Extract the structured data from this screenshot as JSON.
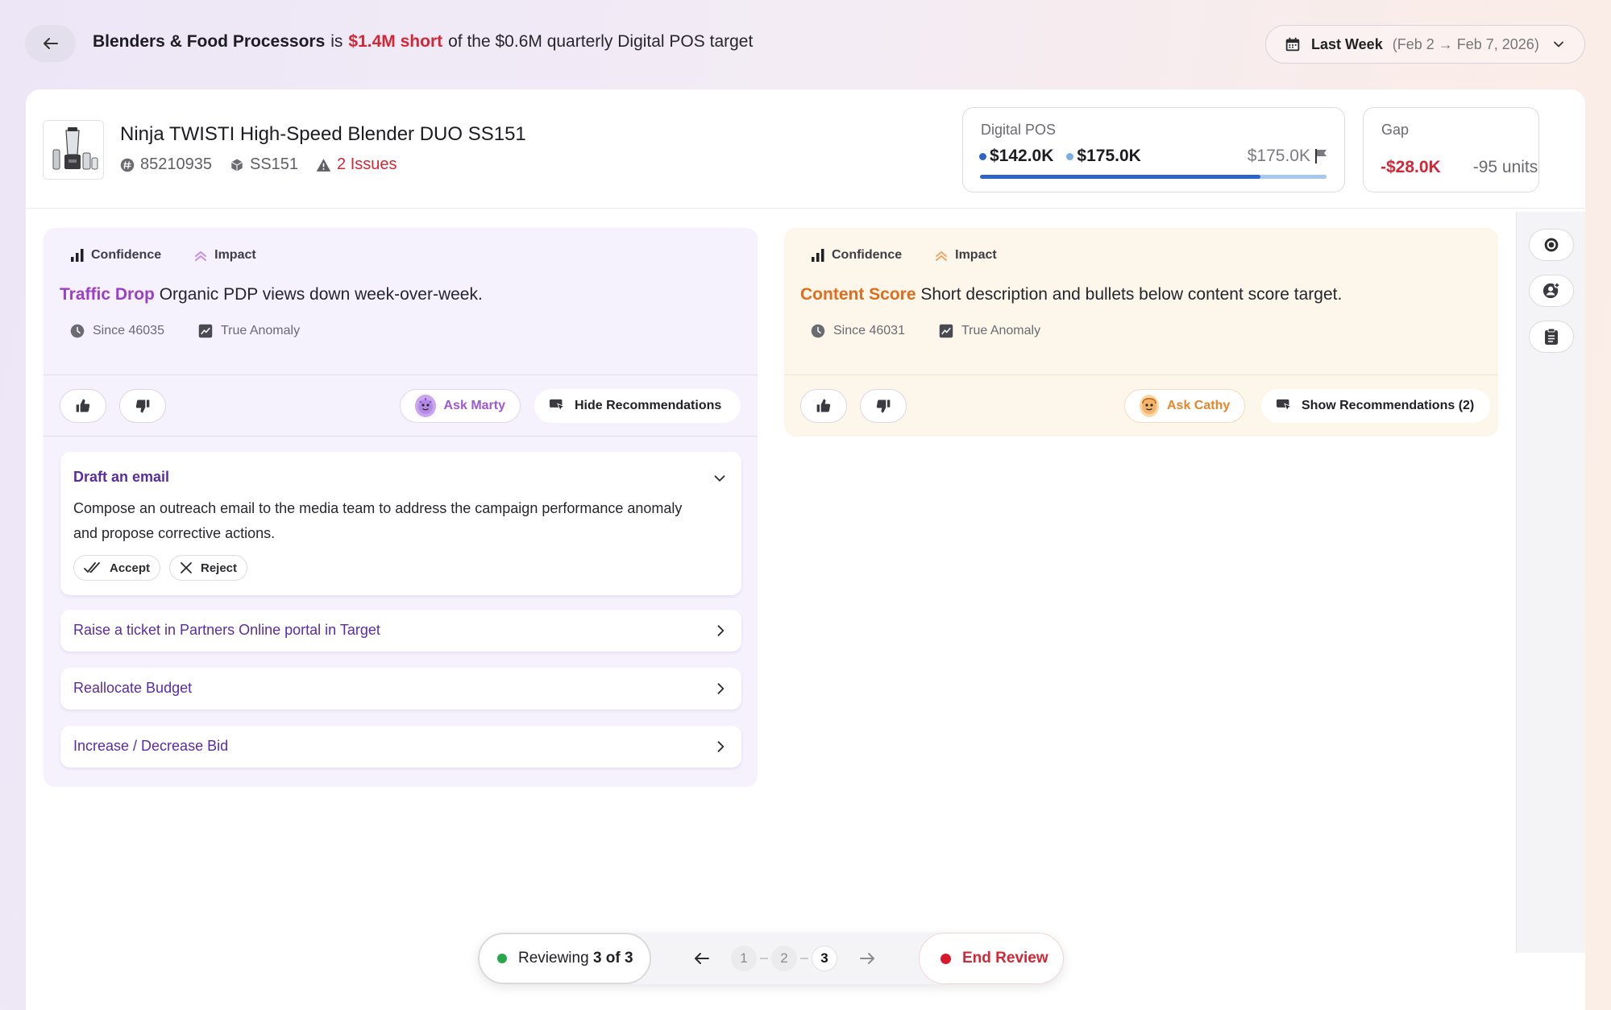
{
  "header": {
    "category": "Blenders & Food Processors",
    "verb": "is",
    "shortfall": "$1.4M short",
    "target_text": "of the $0.6M quarterly Digital POS target"
  },
  "date_filter": {
    "label": "Last Week",
    "range": "(Feb 2 → Feb 7, 2026)"
  },
  "product": {
    "title": "Ninja TWISTI High-Speed Blender DUO SS151",
    "item_id": "85210935",
    "model": "SS151",
    "issues": "2 Issues"
  },
  "kpi_pos": {
    "title": "Digital POS",
    "value_actual": "$142.0K",
    "value_projected": "$175.0K",
    "target": "$175.0K",
    "progress": 0.81,
    "color_actual": "#2d64c8",
    "color_projected": "#7aaee8"
  },
  "kpi_gap": {
    "title": "Gap",
    "amount": "-$28.0K",
    "units": "-95 units"
  },
  "issues": [
    {
      "confidence_label": "Confidence",
      "impact_label": "Impact",
      "keyword": "Traffic Drop",
      "description": "Organic PDP views down week-over-week.",
      "since": "Since 46035",
      "anomaly": "True Anomaly",
      "ask_label": "Ask Marty",
      "recs_label": "Hide Recommendations",
      "recommendations": [
        {
          "title": "Draft an email",
          "body": "Compose an outreach email to the media team to address the campaign performance anomaly and propose corrective actions.",
          "accept": "Accept",
          "reject": "Reject"
        },
        {
          "title": "Raise a ticket in Partners Online portal in Target"
        },
        {
          "title": "Reallocate Budget"
        },
        {
          "title": "Increase / Decrease Bid"
        }
      ]
    },
    {
      "confidence_label": "Confidence",
      "impact_label": "Impact",
      "keyword": "Content Score",
      "description": "Short description and bullets below content score target.",
      "since": "Since 46031",
      "anomaly": "True Anomaly",
      "ask_label": "Ask Cathy",
      "recs_label": "Show Recommendations (2)"
    }
  ],
  "review": {
    "status_prefix": "Reviewing",
    "status_count": "3 of 3",
    "pages": [
      "1",
      "2",
      "3"
    ],
    "current_page": "3",
    "end_label": "End Review"
  },
  "icons": {
    "back": "arrow-left-icon",
    "calendar": "calendar-icon",
    "rail": [
      "target-icon",
      "user-add-icon",
      "clipboard-icon"
    ]
  }
}
